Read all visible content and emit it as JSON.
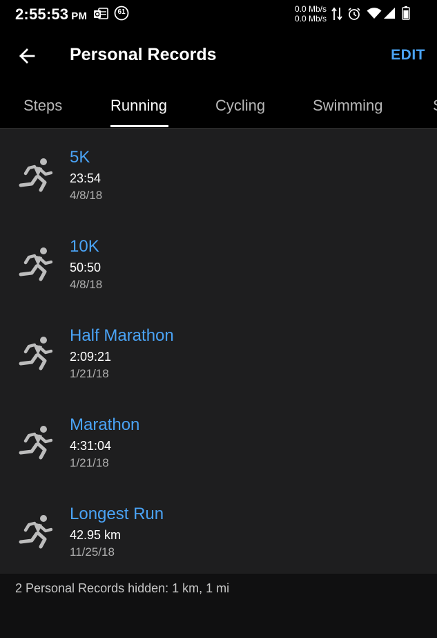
{
  "status_bar": {
    "time": "2:55:53",
    "ampm": "PM",
    "notification_count": "61",
    "net_up": "0.0 Mb/s",
    "net_down": "0.0 Mb/s"
  },
  "header": {
    "title": "Personal Records",
    "edit_label": "EDIT"
  },
  "tabs": [
    {
      "label": "Steps",
      "active": false
    },
    {
      "label": "Running",
      "active": true
    },
    {
      "label": "Cycling",
      "active": false
    },
    {
      "label": "Swimming",
      "active": false
    },
    {
      "label": "S",
      "active": false
    }
  ],
  "records": [
    {
      "title": "5K",
      "value": "23:54",
      "date": "4/8/18",
      "icon": "running-icon"
    },
    {
      "title": "10K",
      "value": "50:50",
      "date": "4/8/18",
      "icon": "running-icon"
    },
    {
      "title": "Half Marathon",
      "value": "2:09:21",
      "date": "1/21/18",
      "icon": "running-icon"
    },
    {
      "title": "Marathon",
      "value": "4:31:04",
      "date": "1/21/18",
      "icon": "running-icon"
    },
    {
      "title": "Longest Run",
      "value": "42.95 km",
      "date": "11/25/18",
      "icon": "running-icon"
    }
  ],
  "footer": {
    "hidden_note": "2 Personal Records hidden: 1 km, 1 mi"
  },
  "colors": {
    "accent": "#4aa3f5",
    "background": "#000000",
    "list_background": "#1e1e1f",
    "icon": "#bdbdbd"
  }
}
